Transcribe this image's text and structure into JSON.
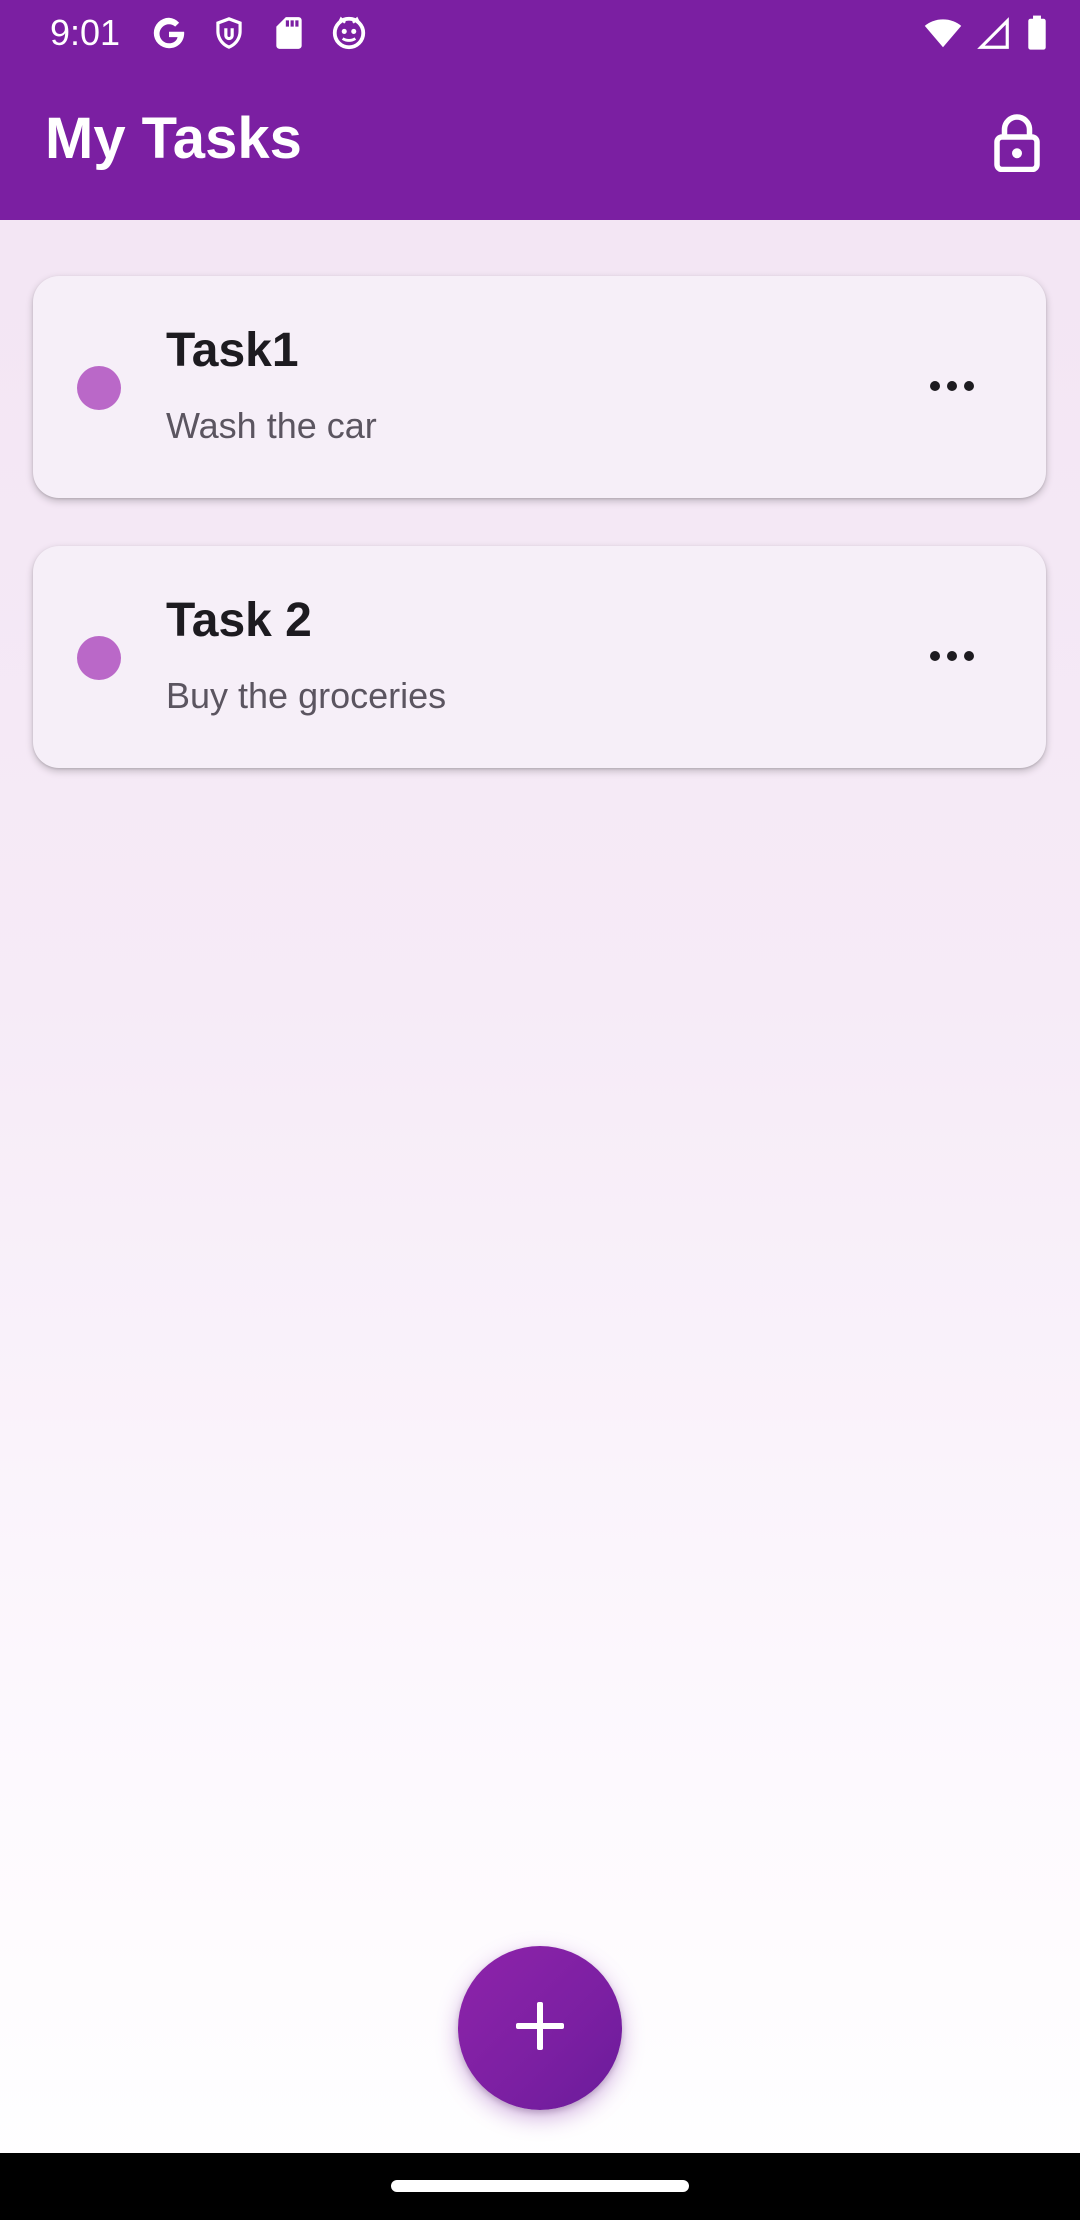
{
  "status_bar": {
    "time": "9:01",
    "left_icons": [
      "google-icon",
      "shield-icon",
      "sd-card-icon",
      "cat-face-icon"
    ],
    "right_icons": [
      "wifi-icon",
      "cell-signal-icon",
      "battery-icon"
    ]
  },
  "app_bar": {
    "title": "My Tasks",
    "action_icon": "lock-icon"
  },
  "tasks": [
    {
      "title": "Task1",
      "description": "Wash the car",
      "dot_color": "#ba68c8",
      "menu_icon": "more-horizontal-icon"
    },
    {
      "title": "Task 2",
      "description": "Buy the groceries",
      "dot_color": "#ba68c8",
      "menu_icon": "more-horizontal-icon"
    }
  ],
  "fab": {
    "icon": "plus-icon"
  },
  "colors": {
    "primary": "#7b1fa2",
    "card_background": "#f6eff8",
    "dot": "#ba68c8",
    "title_text": "#1d1b20",
    "subtitle_text": "#5b5560"
  }
}
